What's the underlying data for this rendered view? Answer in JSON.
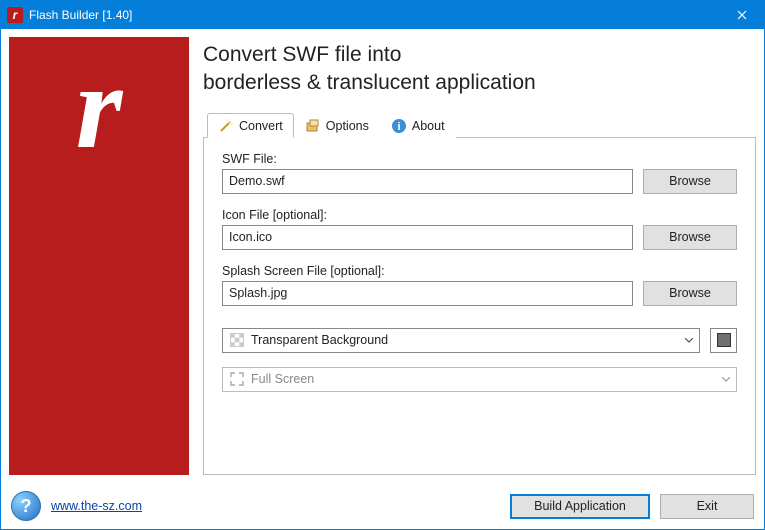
{
  "window": {
    "title": "Flash Builder [1.40]"
  },
  "heading": {
    "line1": "Convert SWF file into",
    "line2": "borderless & translucent application"
  },
  "tabs": {
    "convert": "Convert",
    "options": "Options",
    "about": "About"
  },
  "form": {
    "swf_label": "SWF File:",
    "swf_value": "Demo.swf",
    "icon_label": "Icon File [optional]:",
    "icon_value": "Icon.ico",
    "splash_label": "Splash Screen File [optional]:",
    "splash_value": "Splash.jpg",
    "browse": "Browse",
    "transparent_option": "Transparent Background",
    "fullscreen_option": "Full Screen"
  },
  "footer": {
    "url": "www.the-sz.com",
    "build": "Build Application",
    "exit": "Exit"
  },
  "colors": {
    "brand_red": "#B81D1D",
    "accent_blue": "#057EDA"
  }
}
